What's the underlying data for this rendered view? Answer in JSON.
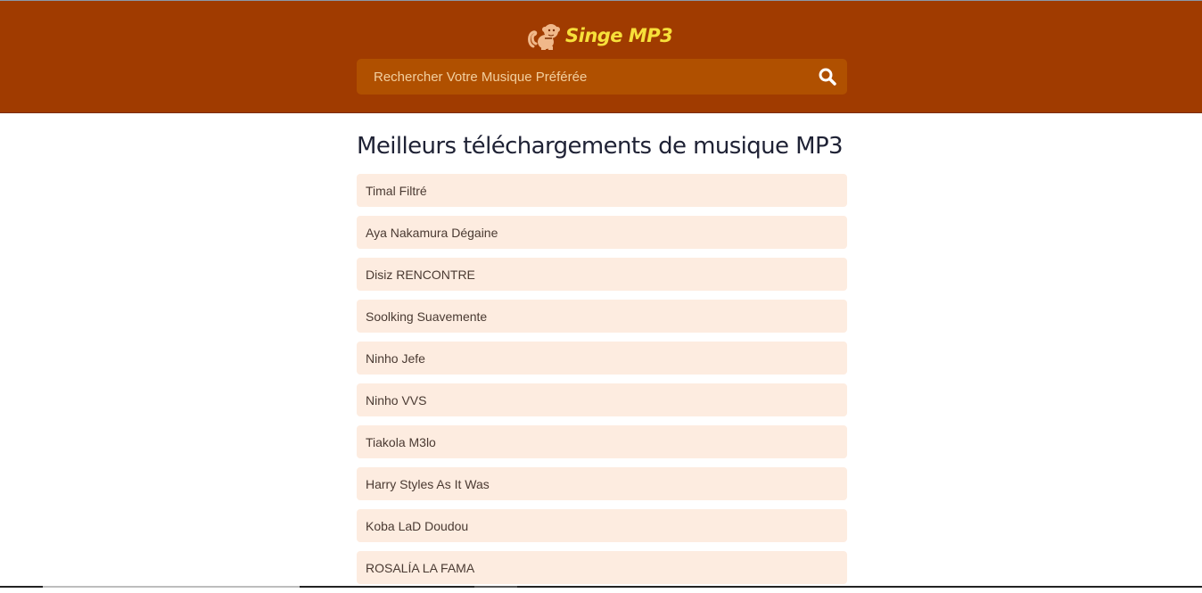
{
  "header": {
    "logo_text": "Singe MP3",
    "logo_icon": "monkey-icon",
    "colors": {
      "header_bg": "#a03b00",
      "search_bg": "#b05000",
      "logo_text": "#f7e03a",
      "item_bg": "#fdece0"
    }
  },
  "search": {
    "placeholder": "Rechercher Votre Musique Préférée",
    "value": "",
    "icon": "search-icon"
  },
  "main": {
    "title": "Meilleurs téléchargements de musique MP3",
    "items": [
      {
        "label": "Timal Filtré"
      },
      {
        "label": "Aya Nakamura Dégaine"
      },
      {
        "label": "Disiz RENCONTRE"
      },
      {
        "label": "Soolking Suavemente"
      },
      {
        "label": "Ninho Jefe"
      },
      {
        "label": "Ninho VVS"
      },
      {
        "label": "Tiakola M3lo"
      },
      {
        "label": "Harry Styles As It Was"
      },
      {
        "label": "Koba LaD Doudou"
      },
      {
        "label": "ROSALÍA LA FAMA"
      }
    ]
  }
}
